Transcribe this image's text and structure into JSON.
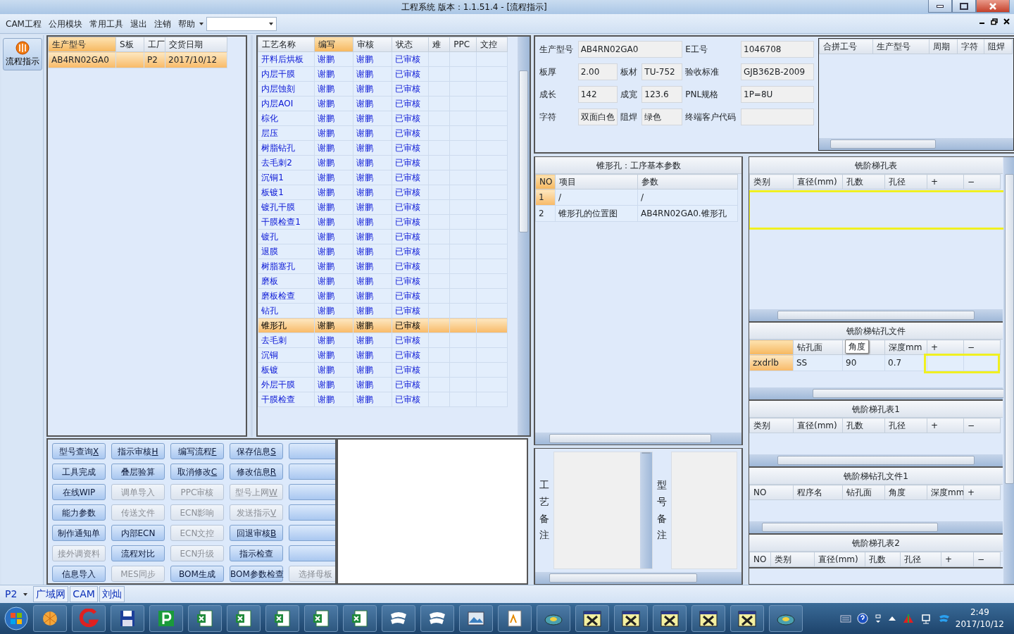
{
  "window": {
    "title": "工程系统   版本：1.1.51.4 - [流程指示]"
  },
  "menu": [
    {
      "label": "CAM工程"
    },
    {
      "label": "公用模块"
    },
    {
      "label": "常用工具"
    },
    {
      "label": "退出"
    },
    {
      "label": "注销"
    },
    {
      "label": "帮助"
    }
  ],
  "sidebar": {
    "items": [
      {
        "label": "流程指示",
        "selected": true
      }
    ]
  },
  "orders": {
    "columns": [
      {
        "label": "生产型号",
        "selected": true
      },
      {
        "label": "S板",
        "selected": false
      },
      {
        "label": "工厂",
        "selected": false
      },
      {
        "label": "交货日期",
        "selected": false
      }
    ],
    "rows": [
      {
        "model": "AB4RN02GA0",
        "factory": "P2",
        "date": "2017/10/12",
        "selected": true
      }
    ]
  },
  "processes": {
    "columns": [
      {
        "label": "工艺名称",
        "selected": false
      },
      {
        "label": "编写",
        "selected": true
      },
      {
        "label": "审核",
        "selected": false
      },
      {
        "label": "状态",
        "selected": false
      },
      {
        "label": "难",
        "selected": false
      },
      {
        "label": "PPC",
        "selected": false
      },
      {
        "label": "文控",
        "selected": false
      }
    ],
    "rows": [
      {
        "cells": [
          "开料后烘板",
          "谢鹏",
          "谢鹏",
          "已审核"
        ],
        "selected": false
      },
      {
        "cells": [
          "内层干膜",
          "谢鹏",
          "谢鹏",
          "已审核"
        ],
        "selected": false
      },
      {
        "cells": [
          "内层蚀刻",
          "谢鹏",
          "谢鹏",
          "已审核"
        ],
        "selected": false
      },
      {
        "cells": [
          "内层AOI",
          "谢鹏",
          "谢鹏",
          "已审核"
        ],
        "selected": false
      },
      {
        "cells": [
          "棕化",
          "谢鹏",
          "谢鹏",
          "已审核"
        ],
        "selected": false
      },
      {
        "cells": [
          "层压",
          "谢鹏",
          "谢鹏",
          "已审核"
        ],
        "selected": false
      },
      {
        "cells": [
          "树脂钻孔",
          "谢鹏",
          "谢鹏",
          "已审核"
        ],
        "selected": false
      },
      {
        "cells": [
          "去毛刺2",
          "谢鹏",
          "谢鹏",
          "已审核"
        ],
        "selected": false
      },
      {
        "cells": [
          "沉铜1",
          "谢鹏",
          "谢鹏",
          "已审核"
        ],
        "selected": false
      },
      {
        "cells": [
          "板镀1",
          "谢鹏",
          "谢鹏",
          "已审核"
        ],
        "selected": false
      },
      {
        "cells": [
          "镀孔干膜",
          "谢鹏",
          "谢鹏",
          "已审核"
        ],
        "selected": false
      },
      {
        "cells": [
          "干膜检查1",
          "谢鹏",
          "谢鹏",
          "已审核"
        ],
        "selected": false
      },
      {
        "cells": [
          "镀孔",
          "谢鹏",
          "谢鹏",
          "已审核"
        ],
        "selected": false
      },
      {
        "cells": [
          "退膜",
          "谢鹏",
          "谢鹏",
          "已审核"
        ],
        "selected": false
      },
      {
        "cells": [
          "树脂塞孔",
          "谢鹏",
          "谢鹏",
          "已审核"
        ],
        "selected": false
      },
      {
        "cells": [
          "磨板",
          "谢鹏",
          "谢鹏",
          "已审核"
        ],
        "selected": false
      },
      {
        "cells": [
          "磨板检查",
          "谢鹏",
          "谢鹏",
          "已审核"
        ],
        "selected": false
      },
      {
        "cells": [
          "钻孔",
          "谢鹏",
          "谢鹏",
          "已审核"
        ],
        "selected": false
      },
      {
        "cells": [
          "锥形孔",
          "谢鹏",
          "谢鹏",
          "已审核"
        ],
        "selected": true
      },
      {
        "cells": [
          "去毛刺",
          "谢鹏",
          "谢鹏",
          "已审核"
        ],
        "selected": false
      },
      {
        "cells": [
          "沉铜",
          "谢鹏",
          "谢鹏",
          "已审核"
        ],
        "selected": false
      },
      {
        "cells": [
          "板镀",
          "谢鹏",
          "谢鹏",
          "已审核"
        ],
        "selected": false
      },
      {
        "cells": [
          "外层干膜",
          "谢鹏",
          "谢鹏",
          "已审核"
        ],
        "selected": false
      },
      {
        "cells": [
          "干膜检查",
          "谢鹏",
          "谢鹏",
          "已审核"
        ],
        "selected": false
      }
    ]
  },
  "buttons": [
    {
      "label": "型号查询",
      "shortcut": "X",
      "disabled": false
    },
    {
      "label": "指示审核",
      "shortcut": "H",
      "disabled": false
    },
    {
      "label": "编写流程",
      "shortcut": "F",
      "disabled": false
    },
    {
      "label": "保存信息",
      "shortcut": "S",
      "disabled": false
    },
    {
      "disabled": false
    },
    {
      "label": "工具完成",
      "disabled": false
    },
    {
      "label": "叠层验算",
      "disabled": false
    },
    {
      "label": "取消修改",
      "shortcut": "C",
      "disabled": false
    },
    {
      "label": "修改信息",
      "shortcut": "R",
      "disabled": false
    },
    {
      "disabled": false
    },
    {
      "label": "在线WIP",
      "disabled": false
    },
    {
      "label": "调单导入",
      "disabled": true
    },
    {
      "label": "PPC审核",
      "disabled": true
    },
    {
      "label": "型号上网",
      "shortcut": "W",
      "disabled": true
    },
    {
      "disabled": false
    },
    {
      "label": "能力参数",
      "disabled": false
    },
    {
      "label": "传送文件",
      "disabled": true
    },
    {
      "label": "ECN影响",
      "disabled": true
    },
    {
      "label": "发送指示",
      "shortcut": "V",
      "disabled": true
    },
    {
      "disabled": false
    },
    {
      "label": "制作通知单",
      "disabled": false
    },
    {
      "label": "内部ECN",
      "disabled": false
    },
    {
      "label": "ECN文控",
      "disabled": true
    },
    {
      "label": "回退审核",
      "shortcut": "B",
      "disabled": false
    },
    {
      "disabled": false
    },
    {
      "label": "接外调资料",
      "disabled": true
    },
    {
      "label": "流程对比",
      "disabled": false
    },
    {
      "label": "ECN升级",
      "disabled": true
    },
    {
      "label": "指示检查",
      "disabled": false
    },
    {
      "disabled": false
    },
    {
      "label": "信息导入",
      "disabled": false
    },
    {
      "label": "MES同步",
      "disabled": true
    },
    {
      "label": "BOM生成",
      "disabled": false
    },
    {
      "label": "BOM参数检查",
      "disabled": false
    },
    {
      "label": "选择母板",
      "disabled": true
    }
  ],
  "info": {
    "fields": [
      {
        "label": "生产型号",
        "value": "AB4RN02GA0"
      },
      {
        "label": "E工号",
        "value": "1046708"
      },
      {
        "label": "板厚",
        "value": "2.00"
      },
      {
        "label": "板材",
        "value": "TU-752"
      },
      {
        "label": "验收标准",
        "value": "GJB362B-2009"
      },
      {
        "label": "成长",
        "value": "142"
      },
      {
        "label": "成宽",
        "value": "123.6"
      },
      {
        "label": "PNL规格",
        "value": "1P=8U"
      },
      {
        "label": "字符",
        "value": "双面白色"
      },
      {
        "label": "阻焊",
        "value": "绿色"
      },
      {
        "label": "终端客户代码"
      }
    ]
  },
  "merge_table": {
    "columns": [
      {
        "label": "合拼工号"
      },
      {
        "label": "生产型号"
      },
      {
        "label": "周期"
      },
      {
        "label": "字符"
      },
      {
        "label": "阻焊"
      }
    ]
  },
  "params": {
    "title": "锥形孔：工序基本参数",
    "columns": [
      {
        "label": "NO",
        "selected": true
      },
      {
        "label": "项目",
        "selected": false
      },
      {
        "label": "参数",
        "selected": false
      }
    ],
    "rows": [
      {
        "cells": [
          "1",
          "/",
          "/"
        ],
        "selected": true
      },
      {
        "cells": [
          "2",
          "锥形孔的位置图",
          "AB4RN02GA0.锥形孔"
        ],
        "selected": false
      }
    ]
  },
  "notes": [
    {
      "label": "工艺备注"
    },
    {
      "label": "型号备注"
    }
  ],
  "hole_tables": [
    {
      "title": "铣阶梯孔表",
      "columns": [
        {
          "label": "类别"
        },
        {
          "label": "直径(mm)"
        },
        {
          "label": "孔数"
        },
        {
          "label": "孔径"
        },
        {
          "label": "+"
        },
        {
          "label": "−"
        }
      ]
    },
    {
      "title": "铣阶梯钻孔文件",
      "columns": [
        {
          "selected": true
        },
        {
          "label": "钻孔面"
        },
        {
          "tooltip": "角度"
        },
        {
          "label": "深度mm"
        },
        {
          "label": "+"
        },
        {
          "label": "−"
        }
      ],
      "rows": [
        {
          "cells": [
            "zxdrlb",
            "SS",
            "90",
            "0.7"
          ]
        }
      ]
    },
    {
      "title": "铣阶梯孔表1",
      "columns": [
        {
          "label": "类别"
        },
        {
          "label": "直径(mm)"
        },
        {
          "label": "孔数"
        },
        {
          "label": "孔径"
        },
        {
          "label": "+"
        },
        {
          "label": "−"
        }
      ]
    },
    {
      "title": "铣阶梯钻孔文件1",
      "columns": [
        {
          "label": "NO"
        },
        {
          "label": "程序名"
        },
        {
          "label": "钻孔面"
        },
        {
          "label": "角度"
        },
        {
          "label": "深度mm"
        },
        {
          "label": "+"
        }
      ]
    },
    {
      "title": "铣阶梯孔表2",
      "columns": [
        {
          "label": "NO"
        },
        {
          "label": "类别"
        },
        {
          "label": "直径(mm)"
        },
        {
          "label": "孔数"
        },
        {
          "label": "孔径"
        },
        {
          "label": "+"
        },
        {
          "label": "−"
        }
      ]
    }
  ],
  "status_bar": {
    "factory": "P2",
    "items": [
      {
        "label": "广域网"
      },
      {
        "label": "CAM"
      },
      {
        "label": "刘灿"
      }
    ]
  },
  "taskbar": {
    "time": "2:49",
    "date": "2017/10/12"
  }
}
